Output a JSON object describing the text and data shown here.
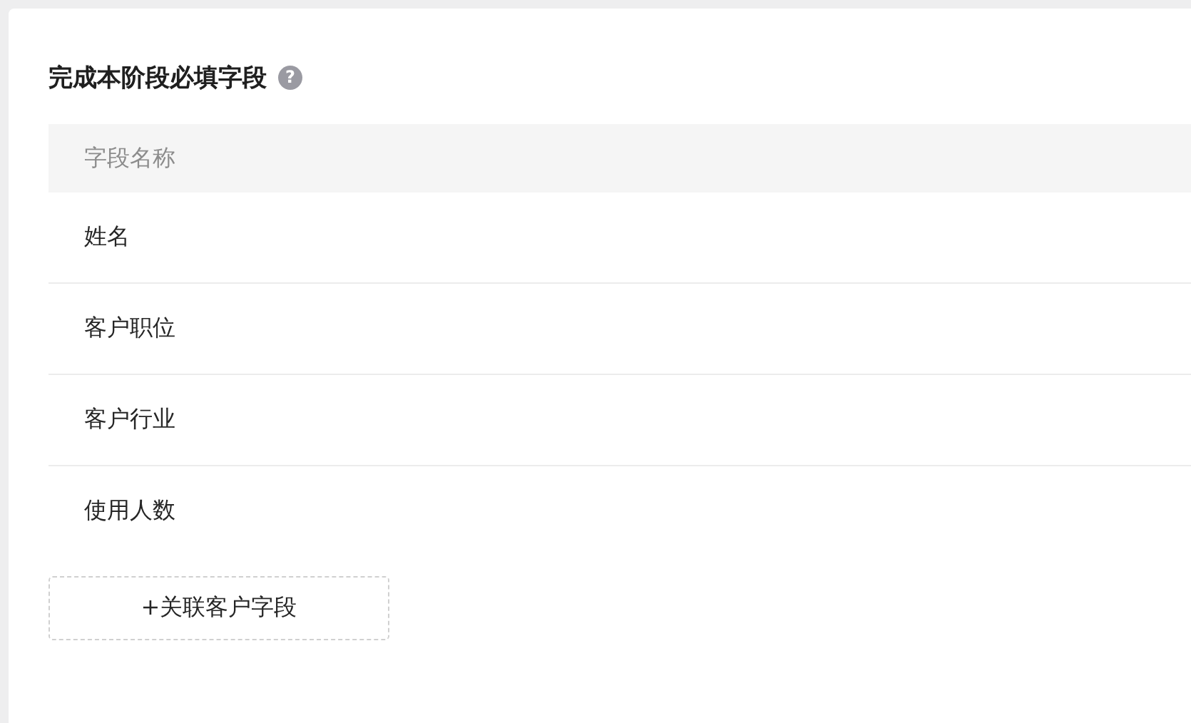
{
  "section": {
    "title": "完成本阶段必填字段",
    "help_icon": "?"
  },
  "table": {
    "columns": [
      "字段名称"
    ],
    "rows": [
      {
        "name": "姓名"
      },
      {
        "name": "客户职位"
      },
      {
        "name": "客户行业"
      },
      {
        "name": "使用人数"
      }
    ]
  },
  "add_button": {
    "label": "+关联客户字段"
  }
}
